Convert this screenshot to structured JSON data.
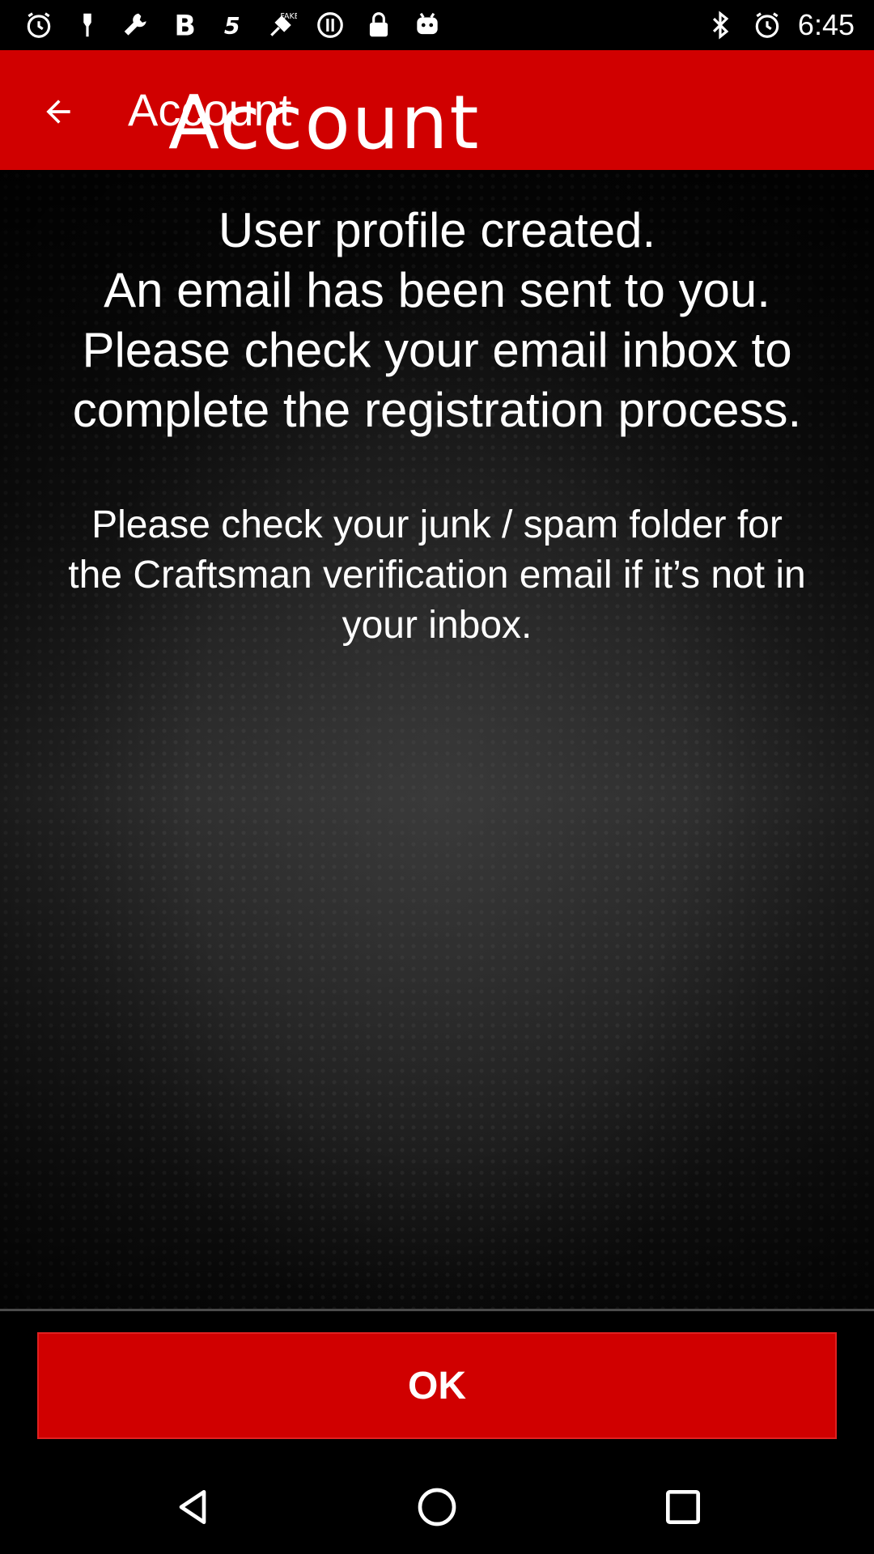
{
  "status_bar": {
    "time": "6:45",
    "left_icons": [
      "alarm-icon",
      "ink-pen-icon",
      "wrench-icon",
      "bold-b-icon",
      "five-icon",
      "fake-gps-icon",
      "info-circle-icon",
      "lock-icon",
      "android-robot-icon"
    ],
    "right_icons": [
      "bluetooth-icon",
      "alarm-icon"
    ]
  },
  "app_bar": {
    "title": "Account",
    "title_overlay": "Account",
    "background_color": "#d00000"
  },
  "message": {
    "primary_lines": [
      "User profile created.",
      "An email has been sent to you.",
      "Please check your email inbox to",
      "complete the registration process."
    ],
    "secondary_lines": [
      "Please check your junk / spam folder for",
      "the Craftsman verification email if it’s not in",
      "your inbox."
    ]
  },
  "actions": {
    "ok_label": "OK",
    "accent_color": "#d00000"
  },
  "nav_bar": {
    "buttons": [
      "back-triangle-icon",
      "home-circle-icon",
      "recents-square-icon"
    ]
  }
}
